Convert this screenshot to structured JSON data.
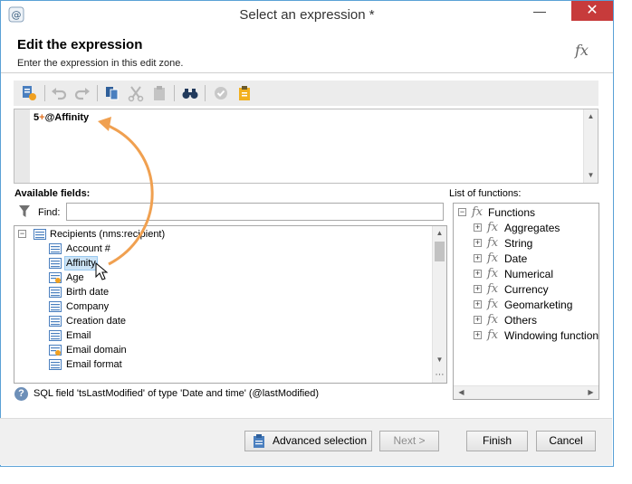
{
  "window": {
    "title": "Select an expression *",
    "minimize": "—",
    "close": "✕"
  },
  "header": {
    "title": "Edit the expression",
    "subtitle": "Enter the expression in this edit zone.",
    "fx_logo": "fx"
  },
  "editor": {
    "num": "5",
    "op": "+",
    "field": "@Affinity"
  },
  "available_fields": {
    "label": "Available fields:",
    "find_label": "Find:",
    "find_value": "",
    "root": "Recipients (nms:recipient)",
    "items": [
      "Account #",
      "Affinity",
      "Age",
      "Birth date",
      "Company",
      "Creation date",
      "Email",
      "Email domain",
      "Email format"
    ]
  },
  "functions": {
    "label": "List of functions:",
    "root": "Functions",
    "items": [
      "Aggregates",
      "String",
      "Date",
      "Numerical",
      "Currency",
      "Geomarketing",
      "Others",
      "Windowing function"
    ]
  },
  "status": {
    "icon": "?",
    "text": "SQL field 'tsLastModified' of type 'Date and time' (@lastModified)"
  },
  "footer": {
    "advanced": "Advanced selection",
    "next": "Next >",
    "finish": "Finish",
    "cancel": "Cancel"
  },
  "tree_glyphs": {
    "collapse": "−",
    "expand": "+",
    "fx": "fx",
    "up": "▲",
    "down": "▼",
    "left": "◀",
    "right": "▶",
    "more": "⋯"
  },
  "colors": {
    "accent": "#f0a050",
    "selection": "#cce4f7",
    "close": "#c73b3b",
    "toolbar_bg": "#ececec"
  }
}
